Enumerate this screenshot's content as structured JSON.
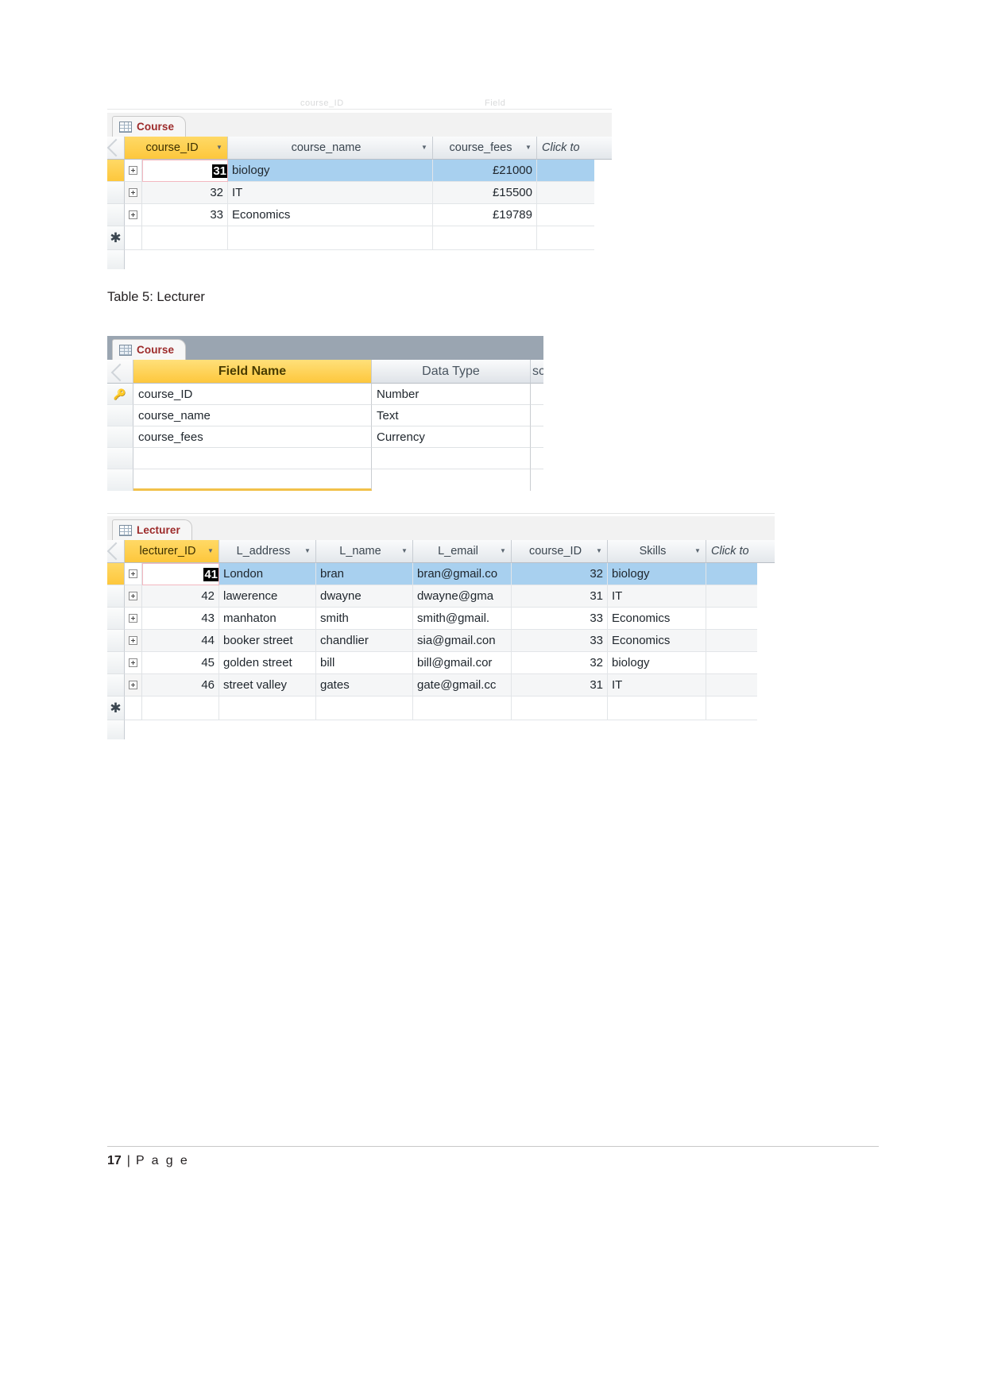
{
  "document": {
    "footer": {
      "page_number": "17",
      "separator": "|",
      "page_word": "P a g e"
    },
    "captions": {
      "table5": "Table 5: Lecturer"
    },
    "ghost_text": {
      "left": "course_ID",
      "right": "Field"
    }
  },
  "screenshot_course_datasheet": {
    "tab_label": "Course",
    "tab_icon": "table-grid-icon",
    "columns": [
      {
        "name": "course_ID",
        "selected": true,
        "has_dropdown": true
      },
      {
        "name": "course_name",
        "selected": false,
        "has_dropdown": true
      },
      {
        "name": "course_fees",
        "selected": false,
        "has_dropdown": true
      },
      {
        "name": "Click to",
        "selected": false,
        "has_dropdown": false
      }
    ],
    "rows": [
      {
        "course_ID": "31",
        "course_name": "biology",
        "course_fees": "£21000",
        "selected": true,
        "focused_cell": "course_ID"
      },
      {
        "course_ID": "32",
        "course_name": "IT",
        "course_fees": "£15500",
        "selected": false
      },
      {
        "course_ID": "33",
        "course_name": "Economics",
        "course_fees": "£19789",
        "selected": false
      }
    ],
    "new_row_marker": "✱"
  },
  "screenshot_course_design": {
    "tab_label": "Course",
    "tab_icon": "table-grid-icon",
    "columns": [
      {
        "name": "Field Name",
        "selected": true
      },
      {
        "name": "Data Type",
        "selected": false
      },
      {
        "name": "scription",
        "selected": false
      }
    ],
    "rows": [
      {
        "field_name": "course_ID",
        "data_type": "Number",
        "primary_key": true,
        "key_icon": "key-icon"
      },
      {
        "field_name": "course_name",
        "data_type": "Text",
        "primary_key": false
      },
      {
        "field_name": "course_fees",
        "data_type": "Currency",
        "primary_key": false
      },
      {
        "field_name": "",
        "data_type": "",
        "primary_key": false
      },
      {
        "field_name": "",
        "data_type": "",
        "primary_key": false
      }
    ]
  },
  "screenshot_lecturer_datasheet": {
    "tab_label": "Lecturer",
    "tab_icon": "table-grid-icon",
    "columns": [
      {
        "name": "lecturer_ID",
        "selected": true,
        "has_dropdown": true
      },
      {
        "name": "L_address",
        "selected": false,
        "has_dropdown": true
      },
      {
        "name": "L_name",
        "selected": false,
        "has_dropdown": true
      },
      {
        "name": "L_email",
        "selected": false,
        "has_dropdown": true
      },
      {
        "name": "course_ID",
        "selected": false,
        "has_dropdown": true
      },
      {
        "name": "Skills",
        "selected": false,
        "has_dropdown": true
      },
      {
        "name": "Click to",
        "selected": false,
        "has_dropdown": false
      }
    ],
    "rows": [
      {
        "lecturer_ID": "41",
        "L_address": "London",
        "L_name": "bran",
        "L_email": "bran@gmail.co",
        "course_ID": "32",
        "Skills": "biology",
        "selected": true,
        "focused_cell": "lecturer_ID"
      },
      {
        "lecturer_ID": "42",
        "L_address": "lawerence",
        "L_name": "dwayne",
        "L_email": "dwayne@gma",
        "course_ID": "31",
        "Skills": "IT",
        "selected": false
      },
      {
        "lecturer_ID": "43",
        "L_address": "manhaton",
        "L_name": "smith",
        "L_email": "smith@gmail.",
        "course_ID": "33",
        "Skills": "Economics",
        "selected": false
      },
      {
        "lecturer_ID": "44",
        "L_address": "booker street",
        "L_name": "chandlier",
        "L_email": "sia@gmail.con",
        "course_ID": "33",
        "Skills": "Economics",
        "selected": false
      },
      {
        "lecturer_ID": "45",
        "L_address": "golden street",
        "L_name": "bill",
        "L_email": "bill@gmail.cor",
        "course_ID": "32",
        "Skills": "biology",
        "selected": false
      },
      {
        "lecturer_ID": "46",
        "L_address": "street valley",
        "L_name": "gates",
        "L_email": "gate@gmail.cc",
        "course_ID": "31",
        "Skills": "IT",
        "selected": false
      }
    ],
    "new_row_marker": "✱"
  },
  "colors": {
    "selected_header": "#fdc73c",
    "selected_row": "#a8d0ef",
    "tab_text": "#9c2a2a",
    "tabstrip": "#9aa5b1",
    "focus_border": "#f3b8c0"
  }
}
